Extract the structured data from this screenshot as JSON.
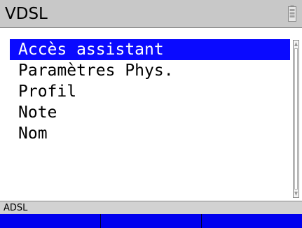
{
  "title": "VDSL",
  "battery_icon": "battery-icon",
  "menu": {
    "items": [
      {
        "label": "Accès assistant",
        "selected": true
      },
      {
        "label": "Paramètres Phys.",
        "selected": false
      },
      {
        "label": "Profil",
        "selected": false
      },
      {
        "label": "Note",
        "selected": false
      },
      {
        "label": "Nom",
        "selected": false
      }
    ]
  },
  "status": {
    "text": "ADSL"
  },
  "softkeys": [
    "",
    "",
    ""
  ],
  "colors": {
    "selection": "#0a0aff",
    "softkey_bar": "#0000ee",
    "title_bar": "#c8c8c8",
    "status_bar": "#d2d2d2"
  }
}
